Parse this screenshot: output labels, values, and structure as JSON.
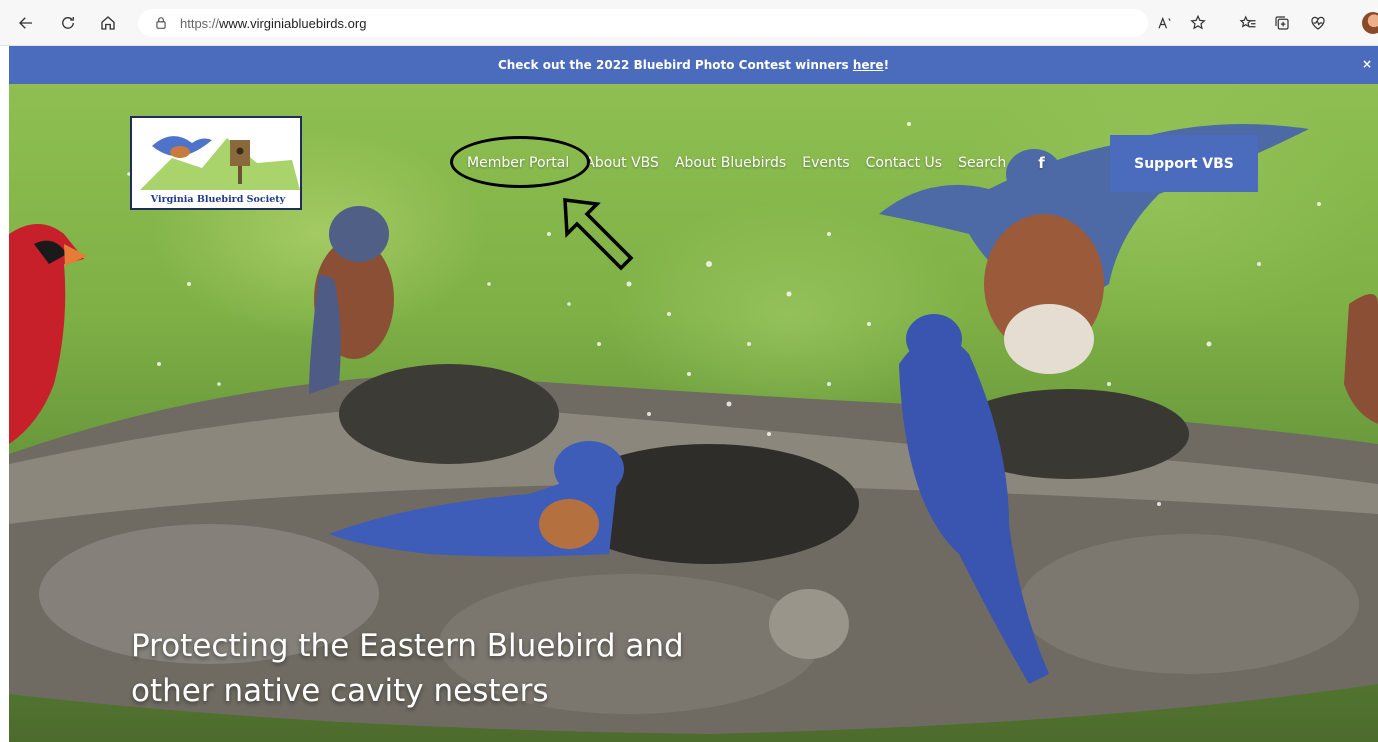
{
  "browser": {
    "url_protocol": "https://",
    "url_host": "www.virginiabluebirds.org"
  },
  "banner": {
    "text_before": "Check out the 2022 Bluebird Photo Contest winners ",
    "link_text": "here",
    "text_after": "!",
    "close_label": "×"
  },
  "logo": {
    "text": "Virginia Bluebird Society"
  },
  "nav": {
    "items": [
      "Member Portal",
      "About VBS",
      "About Bluebirds",
      "Events",
      "Contact Us",
      "Search"
    ],
    "facebook": "f"
  },
  "support_button": "Support VBS",
  "hero": {
    "title_line1": "Protecting the Eastern Bluebird and",
    "title_line2": "other native cavity nesters"
  },
  "colors": {
    "accent": "#4b6bbd",
    "hero_green": "#7eb046",
    "annotation": "#000000"
  },
  "icons": [
    "back-icon",
    "refresh-icon",
    "home-icon",
    "lock-icon",
    "read-aloud-icon",
    "favorite-add-icon",
    "favorites-icon",
    "collections-icon",
    "health-icon",
    "profile-avatar"
  ]
}
